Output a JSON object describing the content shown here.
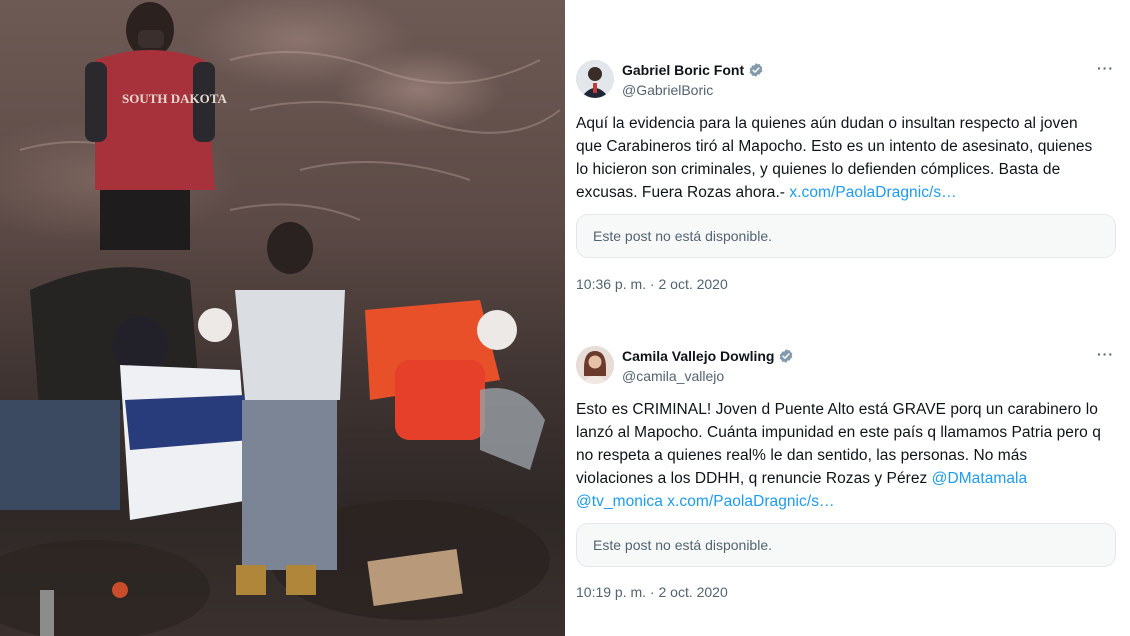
{
  "photo": {
    "shirt_text": "SOUTH DAKOTA",
    "colors": {
      "water": "#6e5a55",
      "rescue_orange": "#e8502a",
      "shirt_red": "#a8323c"
    }
  },
  "tweets": [
    {
      "display_name": "Gabriel Boric Font",
      "handle": "@GabrielBoric",
      "verified_icon": "verified-badge-icon",
      "more_label": "···",
      "text_before_link": "Aquí la evidencia para la quienes aún dudan o insultan respecto al joven que Carabineros tiró al Mapocho. Esto es un intento de asesinato, quienes lo hicieron son criminales, y quienes lo defienden cómplices. Basta de excusas. Fuera Rozas ahora.- ",
      "link_text": "x.com/PaolaDragnic/s…",
      "unavailable_label": "Este post no está disponible.",
      "timestamp": "10:36 p. m. · 2 oct. 2020"
    },
    {
      "display_name": "Camila Vallejo Dowling",
      "handle": "@camila_vallejo",
      "verified_icon": "verified-badge-icon",
      "more_label": "···",
      "text_before_link": "Esto es CRIMINAL! Joven d Puente Alto está GRAVE porq un carabinero lo lanzó al Mapocho. Cuánta impunidad en este país q llamamos Patria pero q no respeta a quienes real% le dan sentido, las personas. No más violaciones a los DDHH, q renuncie Rozas y Pérez ",
      "mention_1": "@DMatamala",
      "mention_2": "@tv_monica",
      "link_text": "x.com/PaolaDragnic/s…",
      "unavailable_label": "Este post no está disponible.",
      "timestamp": "10:19 p. m. · 2 oct. 2020"
    }
  ],
  "colors": {
    "link": "#1d9bf0",
    "verified": "#829aab",
    "secondary_text": "#536471",
    "primary_text": "#0f1419",
    "card_border": "#e4e8eb"
  }
}
